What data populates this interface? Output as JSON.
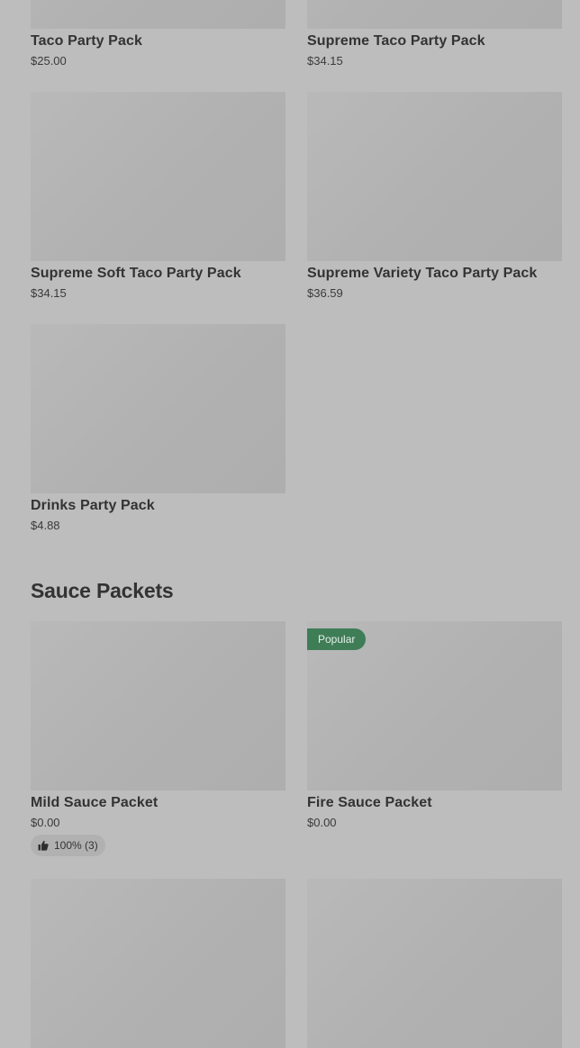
{
  "party_packs": {
    "items": [
      {
        "name": "Taco Party Pack",
        "price": "$25.00"
      },
      {
        "name": "Supreme Taco Party Pack",
        "price": "$34.15"
      },
      {
        "name": "Supreme Soft Taco Party Pack",
        "price": "$34.15"
      },
      {
        "name": "Supreme Variety Taco Party Pack",
        "price": "$36.59"
      },
      {
        "name": "Drinks Party Pack",
        "price": "$4.88"
      }
    ]
  },
  "sauce_packets": {
    "title": "Sauce Packets",
    "items": [
      {
        "name": "Mild Sauce Packet",
        "price": "$0.00",
        "rating": "100% (3)"
      },
      {
        "name": "Fire Sauce Packet",
        "price": "$0.00",
        "badge": "Popular"
      }
    ]
  },
  "icons": {
    "rating": "thumbs-up-icon"
  }
}
